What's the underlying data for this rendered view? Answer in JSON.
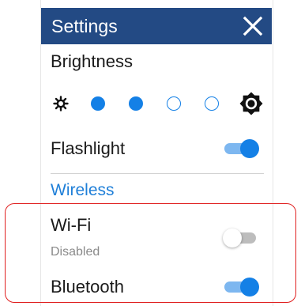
{
  "header": {
    "title": "Settings",
    "close_icon": "close-icon"
  },
  "brightness": {
    "label": "Brightness",
    "levels_total": 4,
    "level": 2,
    "low_icon": "brightness-low-icon",
    "high_icon": "brightness-high-icon"
  },
  "flashlight": {
    "label": "Flashlight",
    "enabled": true
  },
  "wireless": {
    "section_title": "Wireless",
    "wifi": {
      "label": "Wi-Fi",
      "status": "Disabled",
      "enabled": false
    },
    "bluetooth": {
      "label": "Bluetooth",
      "enabled": true
    }
  },
  "colors": {
    "header_bg": "#234a84",
    "accent": "#1480e6",
    "section_text": "#1f7fd8",
    "highlight": "#e02020"
  }
}
